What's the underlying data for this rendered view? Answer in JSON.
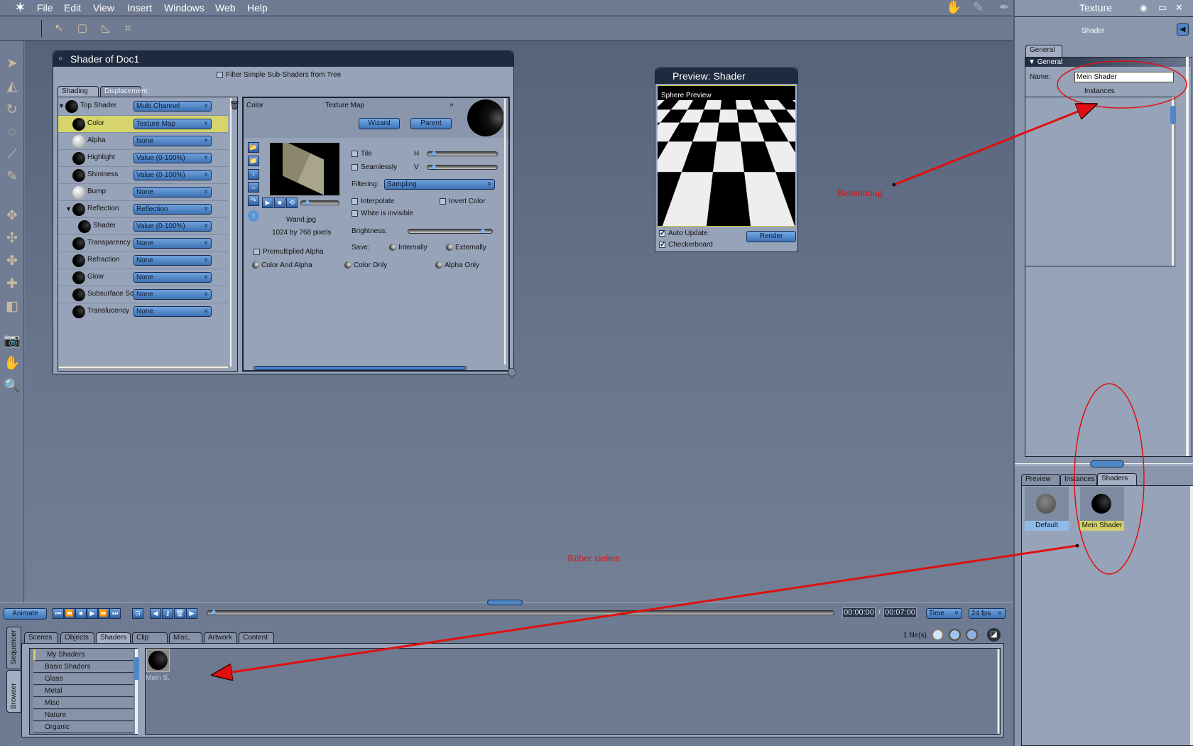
{
  "menubar": {
    "items": [
      "File",
      "Edit",
      "View",
      "Insert",
      "Windows",
      "Web",
      "Help"
    ],
    "room_title": "Texture",
    "room_icons": [
      "hand-icon",
      "brush-icon",
      "pen-icon",
      "quill-icon",
      "film-icon"
    ]
  },
  "toolbar": {
    "tools": [
      "arrow-select-icon",
      "rect-select-icon",
      "lasso-select-icon",
      "polygon-select-icon"
    ]
  },
  "lefttools": [
    "arrow-tool-icon",
    "direct-select-icon",
    "rotate-icon",
    "spin-icon",
    "wand-icon",
    "knife-icon",
    "move-icon",
    "move-xyz-icon",
    "scale-icon",
    "virtual-trackball-icon",
    "box-icon",
    "camera-icon",
    "hand-icon",
    "magnifier-icon"
  ],
  "shader_window": {
    "title": "Shader of Doc1",
    "filter_label": "Filter Simple Sub-Shaders from Tree",
    "tabs": [
      "Shading",
      "Displacement"
    ],
    "tree": [
      {
        "label": "Top Shader",
        "value": "Multi Channel",
        "sphere": "black",
        "level": 0
      },
      {
        "label": "Color",
        "value": "Texture Map",
        "sphere": "black",
        "level": 1,
        "selected": true
      },
      {
        "label": "Alpha",
        "value": "None",
        "sphere": "white",
        "level": 1
      },
      {
        "label": "Highlight",
        "value": "Value (0-100%)",
        "sphere": "black",
        "level": 1
      },
      {
        "label": "Shininess",
        "value": "Value (0-100%)",
        "sphere": "black",
        "level": 1
      },
      {
        "label": "Bump",
        "value": "None",
        "sphere": "white",
        "level": 1
      },
      {
        "label": "Reflection",
        "value": "Reflection",
        "sphere": "black",
        "level": 1
      },
      {
        "label": "Shader",
        "value": "Value (0-100%)",
        "sphere": "black",
        "level": 2
      },
      {
        "label": "Transparency",
        "value": "None",
        "sphere": "black",
        "level": 1
      },
      {
        "label": "Refraction",
        "value": "None",
        "sphere": "black",
        "level": 1
      },
      {
        "label": "Glow",
        "value": "None",
        "sphere": "black",
        "level": 1
      },
      {
        "label": "Subsurface Sc",
        "value": "None",
        "sphere": "black",
        "level": 1
      },
      {
        "label": "Translucency",
        "value": "None",
        "sphere": "black",
        "level": 1
      }
    ],
    "detail": {
      "channel": "Color",
      "type": "Texture Map",
      "wizard": "Wizard",
      "parent": "Parent",
      "filename": "Wand.jpg",
      "dimensions": "1024 by 768 pixels",
      "tile": "Tile",
      "seamlessly": "Seamlessly",
      "h": "H",
      "v": "V",
      "filtering_label": "Filtering:",
      "filtering_value": "Sampling",
      "interpolate": "Interpolate",
      "invert_color": "Invert Color",
      "white_invisible": "White is invisible",
      "brightness": "Brightness:",
      "brightness_level": 0.95,
      "save": "Save:",
      "internally": "Internally",
      "externally": "Externally",
      "premultiplied": "Premultiplied Alpha",
      "color_and_alpha": "Color And Alpha",
      "color_only": "Color Only",
      "alpha_only": "Alpha Only"
    }
  },
  "preview": {
    "title": "Preview: Shader",
    "overlay": "Sphere Preview",
    "auto_update": "Auto Update",
    "checkerboard": "Checkerboard",
    "render": "Render"
  },
  "timeline": {
    "animate": "Animate",
    "current": "00:00:00",
    "separator": "/",
    "total": "00:07:00",
    "mode": "Time",
    "fps": "24 fps"
  },
  "browser": {
    "side_tabs": [
      "Sequencer",
      "Browser"
    ],
    "tabs": [
      "Scenes",
      "Objects",
      "Shaders",
      "Clip",
      "Misc.",
      "Artwork",
      "Content"
    ],
    "active_tab": "Shaders",
    "file_count": "1 file(s).",
    "categories": [
      "My Shaders",
      "Basic Shaders",
      "Glass",
      "Metal",
      "Misc",
      "Nature",
      "Organic"
    ],
    "items": [
      {
        "label": "Mein S."
      }
    ]
  },
  "right": {
    "header": "Shader",
    "tab": "General",
    "section": "General",
    "name_label": "Name:",
    "name_value": "Mein Shader",
    "instances": "Instances",
    "lower_tabs": [
      "Preview",
      "Instances",
      "Shaders"
    ],
    "shaders": [
      {
        "label": "Default"
      },
      {
        "label": "Mein Shader"
      }
    ]
  },
  "annotations": {
    "naming": "Benennung",
    "drag": "Rüber ziehen",
    "color": "#e01010"
  }
}
